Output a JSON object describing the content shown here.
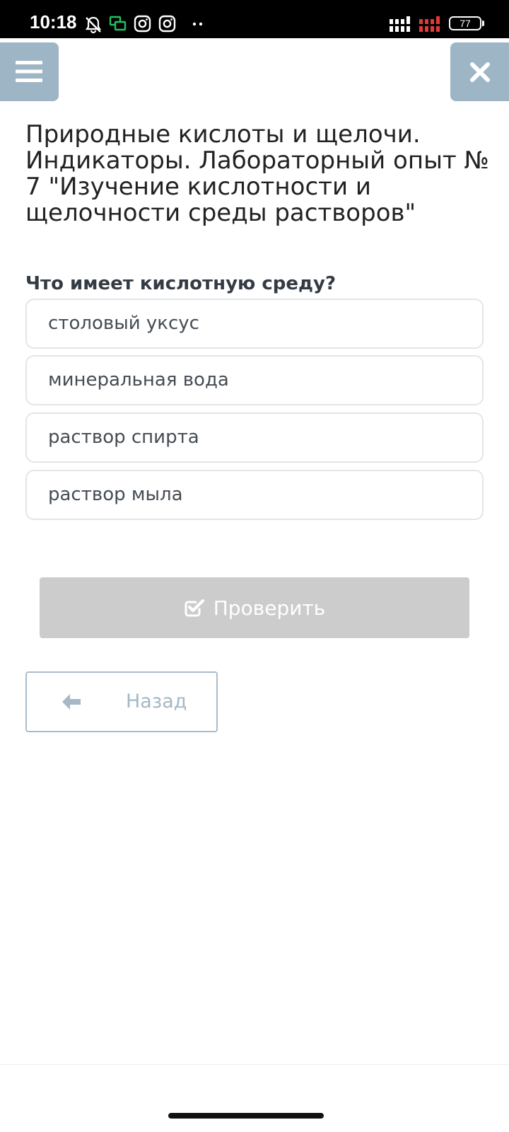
{
  "status_bar": {
    "time": "10:18",
    "battery": "77",
    "icons": [
      "bell-muted-icon",
      "chat-icon",
      "instagram-icon",
      "instagram-icon",
      "more-dots-icon",
      "signal-icon",
      "signal-icon"
    ],
    "colors": {
      "chat_icon": "#21c25e",
      "signal_secondary": "#e53935"
    }
  },
  "header": {
    "menu_icon": "hamburger-menu-icon",
    "close_icon": "close-icon",
    "button_color": "#9eb5c5"
  },
  "page": {
    "title": "Природные кислоты и щелочи. Индикаторы. Лабораторный опыт № 7 \"Изучение кислотности и щелочности среды растворов\""
  },
  "quiz": {
    "question": "Что имеет кислотную среду?",
    "options": [
      {
        "label": "столовый уксус"
      },
      {
        "label": "минеральная вода"
      },
      {
        "label": "раствор спирта"
      },
      {
        "label": "раствор мыла"
      }
    ],
    "check_button": {
      "label": "Проверить",
      "icon": "checkbox-checked-icon",
      "state": "disabled"
    },
    "back_button": {
      "label": "Назад",
      "icon": "arrow-left-icon"
    }
  }
}
